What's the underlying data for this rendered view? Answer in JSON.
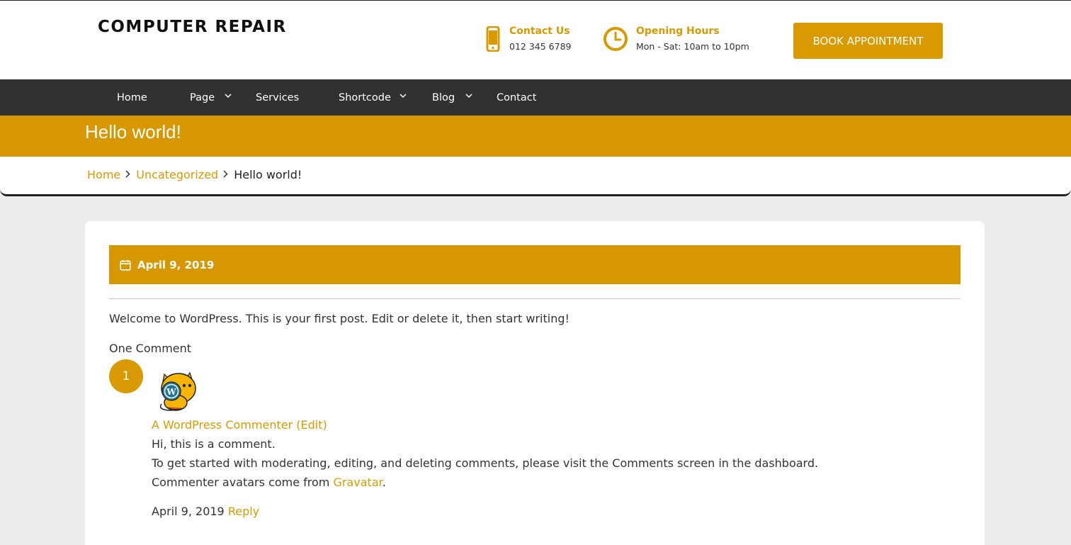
{
  "header": {
    "site_title": "COMPUTER REPAIR",
    "contact": {
      "heading": "Contact Us",
      "value": "012 345 6789",
      "icon": "phone-icon"
    },
    "hours": {
      "heading": "Opening Hours",
      "value": "Mon - Sat: 10am to 10pm",
      "icon": "clock-icon"
    },
    "book_button": "BOOK APPOINTMENT",
    "accent_color": "#d89a00"
  },
  "nav": {
    "items": [
      {
        "label": "Home",
        "has_dropdown": false
      },
      {
        "label": "Page",
        "has_dropdown": true
      },
      {
        "label": "Services",
        "has_dropdown": false
      },
      {
        "label": "Shortcode",
        "has_dropdown": true
      },
      {
        "label": "Blog",
        "has_dropdown": true
      },
      {
        "label": "Contact",
        "has_dropdown": false
      }
    ]
  },
  "banner": {
    "title": "Hello world!"
  },
  "breadcrumb": {
    "items": [
      "Home",
      "Uncategorized"
    ],
    "current": "Hello world!"
  },
  "post": {
    "date": "April 9, 2019",
    "body": "Welcome to WordPress. This is your first post. Edit or delete it, then start writing!",
    "comments_title": "One Comment",
    "comment_count": "1",
    "comment": {
      "author": "A WordPress Commenter",
      "edit_label": "(Edit)",
      "lines": [
        "Hi, this is a comment.",
        "To get started with moderating, editing, and deleting comments, please visit the Comments screen in the dashboard."
      ],
      "avatar_line_prefix": "Commenter avatars come from ",
      "avatar_link": "Gravatar",
      "avatar_line_suffix": ".",
      "date": "April 9, 2019",
      "reply_label": "Reply"
    }
  }
}
